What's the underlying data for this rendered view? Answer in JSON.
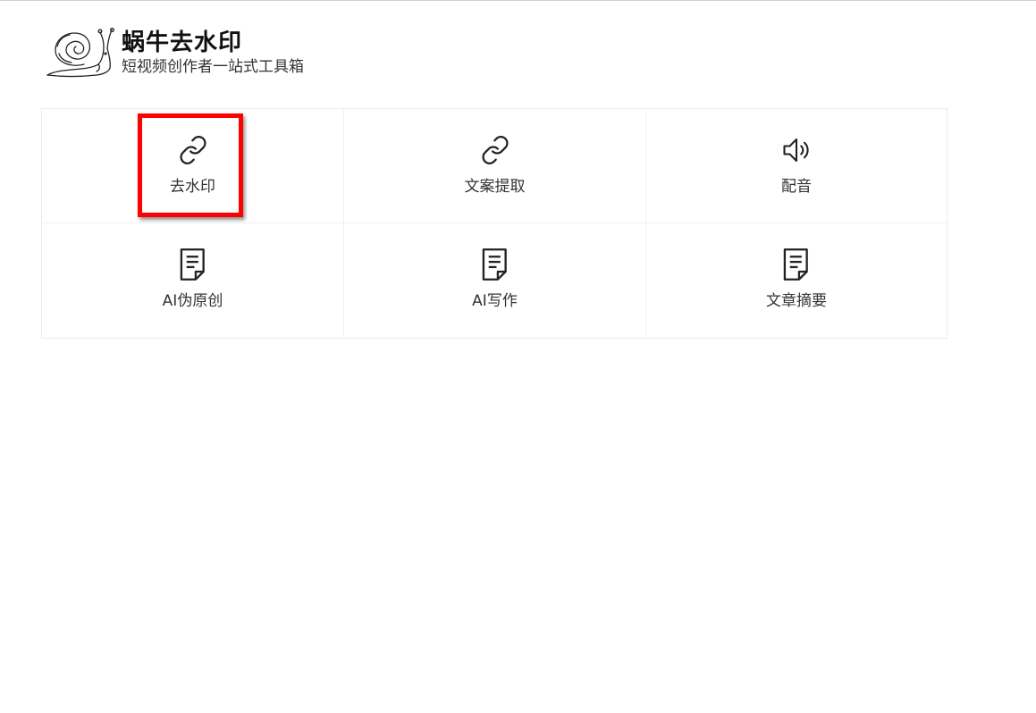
{
  "brand": {
    "title": "蜗牛去水印",
    "subtitle": "短视频创作者一站式工具箱",
    "logo_icon": "snail-icon"
  },
  "tools": [
    {
      "label": "去水印",
      "icon": "link-icon"
    },
    {
      "label": "文案提取",
      "icon": "link-icon"
    },
    {
      "label": "配音",
      "icon": "speaker-icon"
    },
    {
      "label": "AI伪原创",
      "icon": "document-icon"
    },
    {
      "label": "AI写作",
      "icon": "document-icon"
    },
    {
      "label": "文章摘要",
      "icon": "document-icon"
    }
  ],
  "highlight": {
    "target": "去水印",
    "color": "#ff0000"
  },
  "colors": {
    "border": "#ebebeb",
    "text": "#333333",
    "highlight": "#ff0000"
  }
}
